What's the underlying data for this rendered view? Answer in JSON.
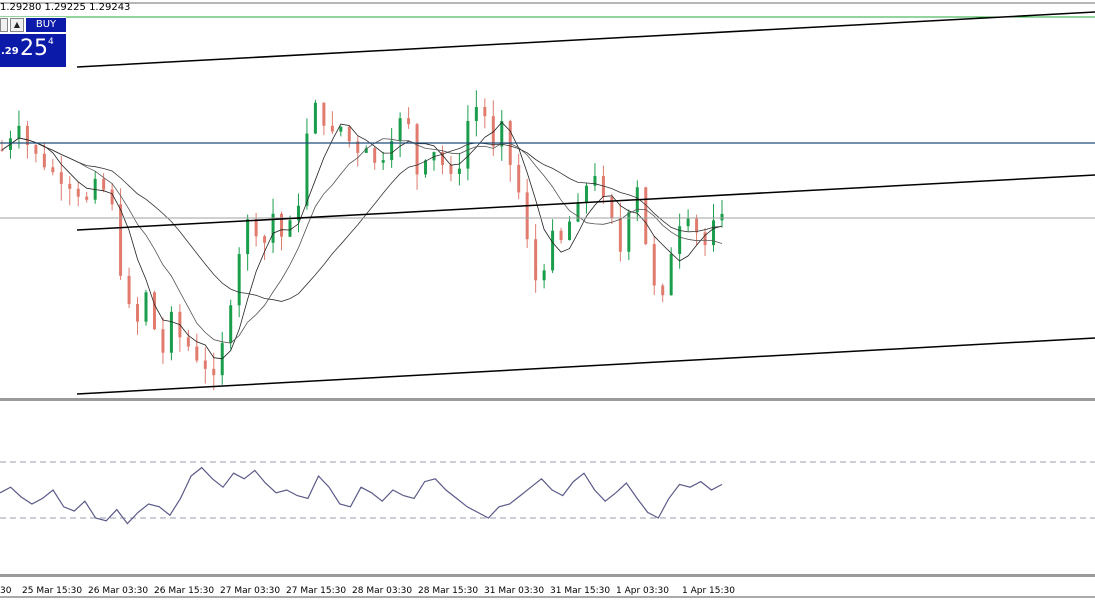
{
  "chart_header": {
    "ohlc_text": "1.29280 1.29225 1.29243"
  },
  "trade_panel": {
    "dropdown_glyph": "",
    "arrow_glyph": "▲",
    "buy_label": "BUY",
    "price_small": ".29",
    "price_big": "25",
    "price_sup": "4",
    "color": "#0b1aa8"
  },
  "x_axis_labels": [
    "30",
    "25 Mar 15:30",
    "26 Mar 03:30",
    "26 Mar 15:30",
    "27 Mar 03:30",
    "27 Mar 15:30",
    "28 Mar 03:30",
    "28 Mar 15:30",
    "31 Mar 03:30",
    "31 Mar 15:30",
    "1 Apr 03:30",
    "1 Apr 15:30"
  ],
  "colors": {
    "bull": "#1a9e4b",
    "bear": "#e07b6e",
    "channel": "#000000",
    "hline": "#1f4e79",
    "green_line": "#27a83a",
    "oscillator": "#5a5a8a"
  },
  "chart_data": {
    "type": "candlestick",
    "title": "",
    "xlabel": "",
    "ylabel": "",
    "grid": false,
    "price_range": [
      1.2845,
      1.2975
    ],
    "price_points": [
      1.293,
      1.2935,
      1.294,
      1.2932,
      1.2928,
      1.2925,
      1.2922,
      1.292,
      1.2918,
      1.2915,
      1.2912,
      1.2918,
      1.2916,
      1.291,
      1.2888,
      1.2875,
      1.287,
      1.288,
      1.2868,
      1.286,
      1.2872,
      1.2865,
      1.2862,
      1.2858,
      1.2855,
      1.285,
      1.2862,
      1.2878,
      1.2895,
      1.2905,
      1.2902,
      1.2898,
      1.2908,
      1.29,
      1.2904,
      1.2912,
      1.2935,
      1.2945,
      1.294,
      1.2935,
      1.2938,
      1.2933,
      1.293,
      1.2932,
      1.2925,
      1.2928,
      1.2935,
      1.294,
      1.2938,
      1.2922,
      1.2928,
      1.293,
      1.2925,
      1.292,
      1.2925,
      1.294,
      1.2945,
      1.2942,
      1.293,
      1.2938,
      1.2925,
      1.2915,
      1.2898,
      1.2885,
      1.289,
      1.29,
      1.2898,
      1.2905,
      1.291,
      1.2918,
      1.2922,
      1.2912,
      1.2905,
      1.2895,
      1.291,
      1.2918,
      1.2898,
      1.2882,
      1.2878,
      1.2895,
      1.2905,
      1.2908,
      1.2902,
      1.2897,
      1.2904,
      1.2906
    ],
    "oscillator_points": [
      48,
      52,
      45,
      40,
      44,
      50,
      38,
      35,
      42,
      30,
      28,
      36,
      26,
      34,
      40,
      38,
      32,
      44,
      60,
      66,
      58,
      52,
      62,
      58,
      64,
      55,
      48,
      50,
      46,
      44,
      60,
      52,
      40,
      38,
      52,
      48,
      42,
      50,
      46,
      44,
      56,
      58,
      50,
      44,
      38,
      34,
      30,
      38,
      40,
      46,
      52,
      58,
      50,
      46,
      56,
      62,
      50,
      42,
      48,
      55,
      44,
      34,
      30,
      44,
      54,
      52,
      56,
      50,
      54
    ],
    "oscillator_levels": [
      70,
      30
    ]
  }
}
